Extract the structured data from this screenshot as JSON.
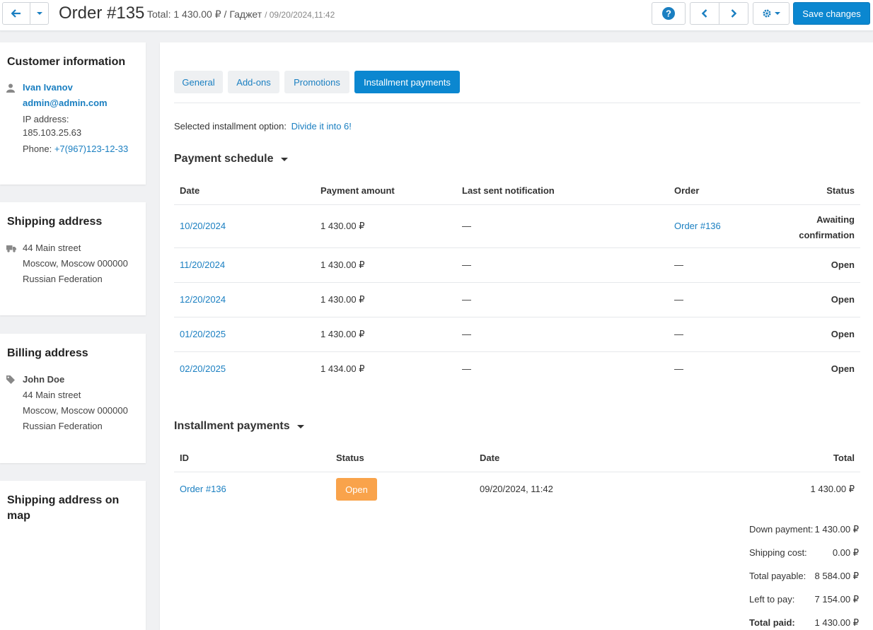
{
  "header": {
    "title": "Order #135",
    "subtitle": "Total: 1 430.00 ₽ / Гаджет",
    "date": "/ 09/20/2024,11:42",
    "save_label": "Save changes"
  },
  "sidebar": {
    "customer": {
      "title": "Customer information",
      "name": "Ivan Ivanov",
      "email": "admin@admin.com",
      "ip_label": "IP address:",
      "ip": "185.103.25.63",
      "phone_label": "Phone:",
      "phone": "+7(967)123-12-33"
    },
    "shipping": {
      "title": "Shipping address",
      "street": "44 Main street",
      "city": "Moscow, Moscow 000000",
      "country": "Russian Federation"
    },
    "billing": {
      "title": "Billing address",
      "name": "John Doe",
      "street": "44 Main street",
      "city": "Moscow, Moscow 000000",
      "country": "Russian Federation"
    },
    "map": {
      "title_line1": "Shipping address on",
      "title_line2": "map"
    }
  },
  "tabs": [
    {
      "label": "General"
    },
    {
      "label": "Add-ons"
    },
    {
      "label": "Promotions"
    },
    {
      "label": "Installment payments"
    }
  ],
  "installment_option": {
    "label": "Selected installment option:",
    "value": "Divide it into 6!"
  },
  "schedule": {
    "title": "Payment schedule",
    "headers": {
      "date": "Date",
      "amount": "Payment amount",
      "notification": "Last sent notification",
      "order": "Order",
      "status": "Status"
    },
    "rows": [
      {
        "date": "10/20/2024",
        "amount": "1 430.00 ₽",
        "notification": "—",
        "order": "Order #136",
        "status_line1": "Awaiting",
        "status_line2": "confirmation"
      },
      {
        "date": "11/20/2024",
        "amount": "1 430.00 ₽",
        "notification": "—",
        "order": "—",
        "status": "Open"
      },
      {
        "date": "12/20/2024",
        "amount": "1 430.00 ₽",
        "notification": "—",
        "order": "—",
        "status": "Open"
      },
      {
        "date": "01/20/2025",
        "amount": "1 430.00 ₽",
        "notification": "—",
        "order": "—",
        "status": "Open"
      },
      {
        "date": "02/20/2025",
        "amount": "1 434.00 ₽",
        "notification": "—",
        "order": "—",
        "status": "Open"
      }
    ]
  },
  "payments": {
    "title": "Installment payments",
    "headers": {
      "id": "ID",
      "status": "Status",
      "date": "Date",
      "total": "Total"
    },
    "rows": [
      {
        "id": "Order #136",
        "status": "Open",
        "date": "09/20/2024, 11:42",
        "total": "1 430.00 ₽"
      }
    ]
  },
  "summary": [
    {
      "label": "Down payment:",
      "value": "1 430.00 ₽"
    },
    {
      "label": "Shipping cost:",
      "value": "0.00 ₽"
    },
    {
      "label": "Total payable:",
      "value": "8 584.00 ₽"
    },
    {
      "label": "Left to pay:",
      "value": "7 154.00 ₽"
    },
    {
      "label": "Total paid:",
      "value": "1 430.00 ₽"
    }
  ],
  "colors": {
    "accent": "#0b87d0",
    "link": "#1a7fc1",
    "badge_open": "#f9a34b"
  }
}
